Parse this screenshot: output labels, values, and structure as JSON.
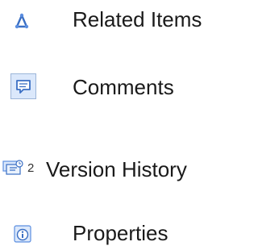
{
  "panel": {
    "items": [
      {
        "label": "Related Items",
        "icon": "related-items-icon"
      },
      {
        "label": "Comments",
        "icon": "comments-icon"
      },
      {
        "label": "Version History",
        "icon": "version-history-icon",
        "count": "2"
      },
      {
        "label": "Properties",
        "icon": "properties-icon"
      }
    ]
  },
  "colors": {
    "icon_blue": "#3a6fc4",
    "icon_light_blue": "#dbe8fb",
    "comment_frame": "#9db6d9"
  }
}
